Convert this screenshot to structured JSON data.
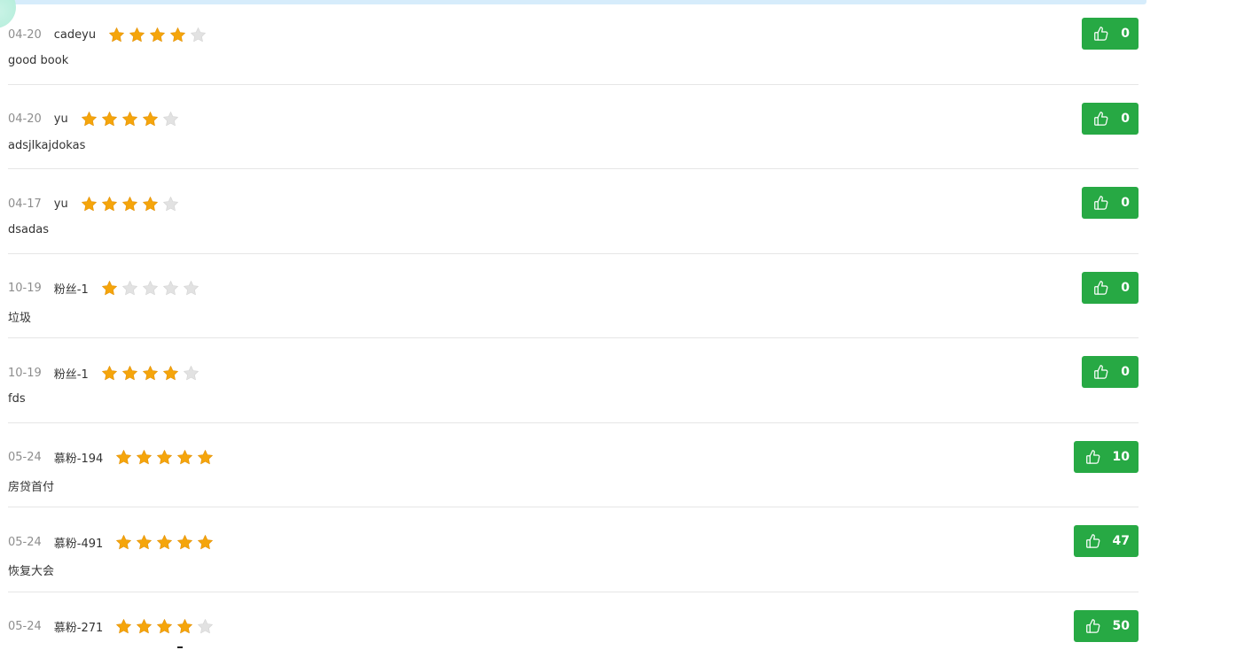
{
  "colors": {
    "star_filled": "#f5a50b",
    "star_empty": "#e2e2e2",
    "like_button": "#27a944",
    "top_band": "#d6ecfb"
  },
  "icons": {
    "star": "star-icon",
    "like": "thumbs-up-icon"
  },
  "rating_max": 5,
  "comments": [
    {
      "date": "04-20",
      "user": "cadeyu",
      "rating": 4,
      "text": "good book",
      "likes": "0"
    },
    {
      "date": "04-20",
      "user": "yu",
      "rating": 4,
      "text": "adsjlkajdokas",
      "likes": "0"
    },
    {
      "date": "04-17",
      "user": "yu",
      "rating": 4,
      "text": "dsadas",
      "likes": "0"
    },
    {
      "date": "10-19",
      "user": "粉丝-1",
      "rating": 1,
      "text": "垃圾",
      "likes": "0"
    },
    {
      "date": "10-19",
      "user": "粉丝-1",
      "rating": 4,
      "text": "fds",
      "likes": "0"
    },
    {
      "date": "05-24",
      "user": "慕粉-194",
      "rating": 5,
      "text": "房贷首付",
      "likes": "10"
    },
    {
      "date": "05-24",
      "user": "慕粉-491",
      "rating": 5,
      "text": "恢复大会",
      "likes": "47"
    },
    {
      "date": "05-24",
      "user": "慕粉-271",
      "rating": 4,
      "text": "",
      "likes": "50"
    }
  ]
}
